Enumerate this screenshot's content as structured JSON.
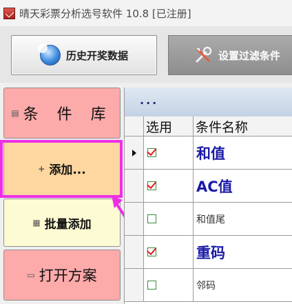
{
  "window": {
    "title": "晴天彩票分析选号软件 10.8 [已注册]"
  },
  "toolbar": {
    "history_label": "历史开奖数据",
    "filter_label": "设置过滤条件"
  },
  "nav": {
    "conditions_label": "条 件 库",
    "add_label": "添加...",
    "batch_add_label": "批量添加",
    "open_plan_label": "打开方案"
  },
  "grid": {
    "caption": "...",
    "headers": {
      "select": "选用",
      "name": "条件名称"
    },
    "rows": [
      {
        "name": "和值",
        "checked": true,
        "current": true,
        "style": "large"
      },
      {
        "name": "AC值",
        "checked": true,
        "current": false,
        "style": "large"
      },
      {
        "name": "和值尾",
        "checked": false,
        "current": false,
        "style": "small"
      },
      {
        "name": "重码",
        "checked": true,
        "current": false,
        "style": "large"
      },
      {
        "name": "邻码",
        "checked": false,
        "current": false,
        "style": "small"
      }
    ]
  },
  "colors": {
    "highlight": "#ee2ee6",
    "nav_pink": "#fcaaaa",
    "nav_orange": "#fdd6a0",
    "nav_yellow": "#fdfbd3",
    "name_blue": "#1a1aa8",
    "check_red": "#e01818"
  },
  "icons": {
    "app": "app-icon",
    "history": "globe-icon",
    "filter": "tools-icon",
    "conditions": "list-icon",
    "add": "plus-icon",
    "batch": "grid-icon",
    "open": "folder-icon"
  }
}
